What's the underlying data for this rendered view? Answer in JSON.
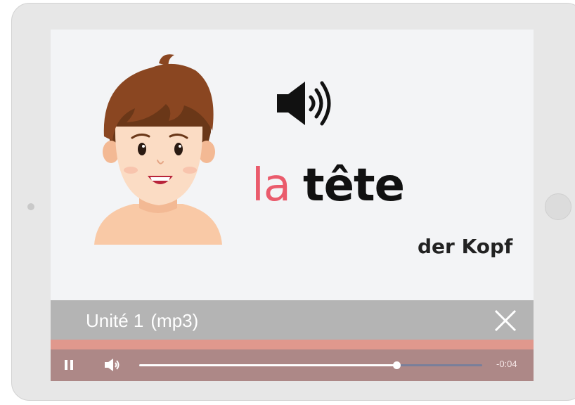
{
  "lesson": {
    "article": "la",
    "word": "tête",
    "translation": "der Kopf"
  },
  "icons": {
    "illustration": "boy-face-icon",
    "speaker": "speaker-icon",
    "close": "close-icon",
    "pause": "pause-icon",
    "volume": "volume-icon"
  },
  "player": {
    "title": "Unité 1",
    "subtitle": "(mp3)",
    "time_remaining": "-0:04",
    "progress": 0.75
  },
  "colors": {
    "article_accent": "#ea5b6c",
    "player_header": "#b4b4b4",
    "accent_strip": "#e0988d",
    "controls_bar": "#ad8887",
    "track_remaining": "#7a7f9a"
  }
}
